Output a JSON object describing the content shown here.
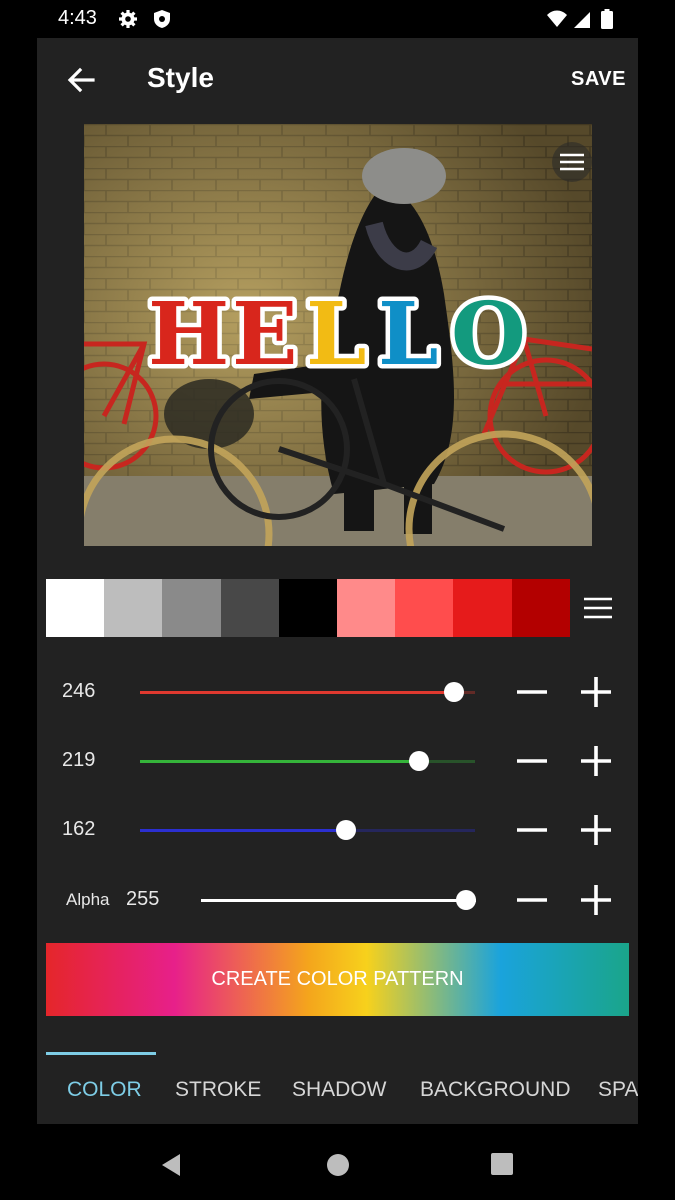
{
  "status_bar": {
    "time": "4:43",
    "icons": [
      "gear-icon",
      "shield-icon",
      "wifi-icon",
      "signal-icon",
      "battery-icon"
    ]
  },
  "toolbar": {
    "title": "Style",
    "save_label": "SAVE"
  },
  "preview": {
    "overlay_text": "HELLO",
    "letter_colors": [
      "#d8261c",
      "#d8261c",
      "#f2bb14",
      "#0f8fc7",
      "#139a7e"
    ]
  },
  "palette": {
    "swatches": [
      "#ffffff",
      "#bdbdbd",
      "#8a8a8a",
      "#484848",
      "#000000",
      "#ff8a8a",
      "#ff4d4d",
      "#e61b1b",
      "#b30000"
    ]
  },
  "sliders": [
    {
      "label": "",
      "value": "246",
      "level": 246,
      "max": 255,
      "color": "#e0392f"
    },
    {
      "label": "",
      "value": "219",
      "level": 219,
      "max": 255,
      "color": "#35b43a"
    },
    {
      "label": "",
      "value": "162",
      "level": 162,
      "max": 255,
      "color": "#2b2fd0"
    },
    {
      "label": "Alpha",
      "value": "255",
      "level": 255,
      "max": 255,
      "color": "#ffffff"
    }
  ],
  "pattern_button": {
    "label": "CREATE COLOR PATTERN"
  },
  "tabs": [
    {
      "label": "COLOR",
      "active": true
    },
    {
      "label": "STROKE",
      "active": false
    },
    {
      "label": "SHADOW",
      "active": false
    },
    {
      "label": "BACKGROUND",
      "active": false
    },
    {
      "label": "SPACING",
      "active": false
    }
  ]
}
